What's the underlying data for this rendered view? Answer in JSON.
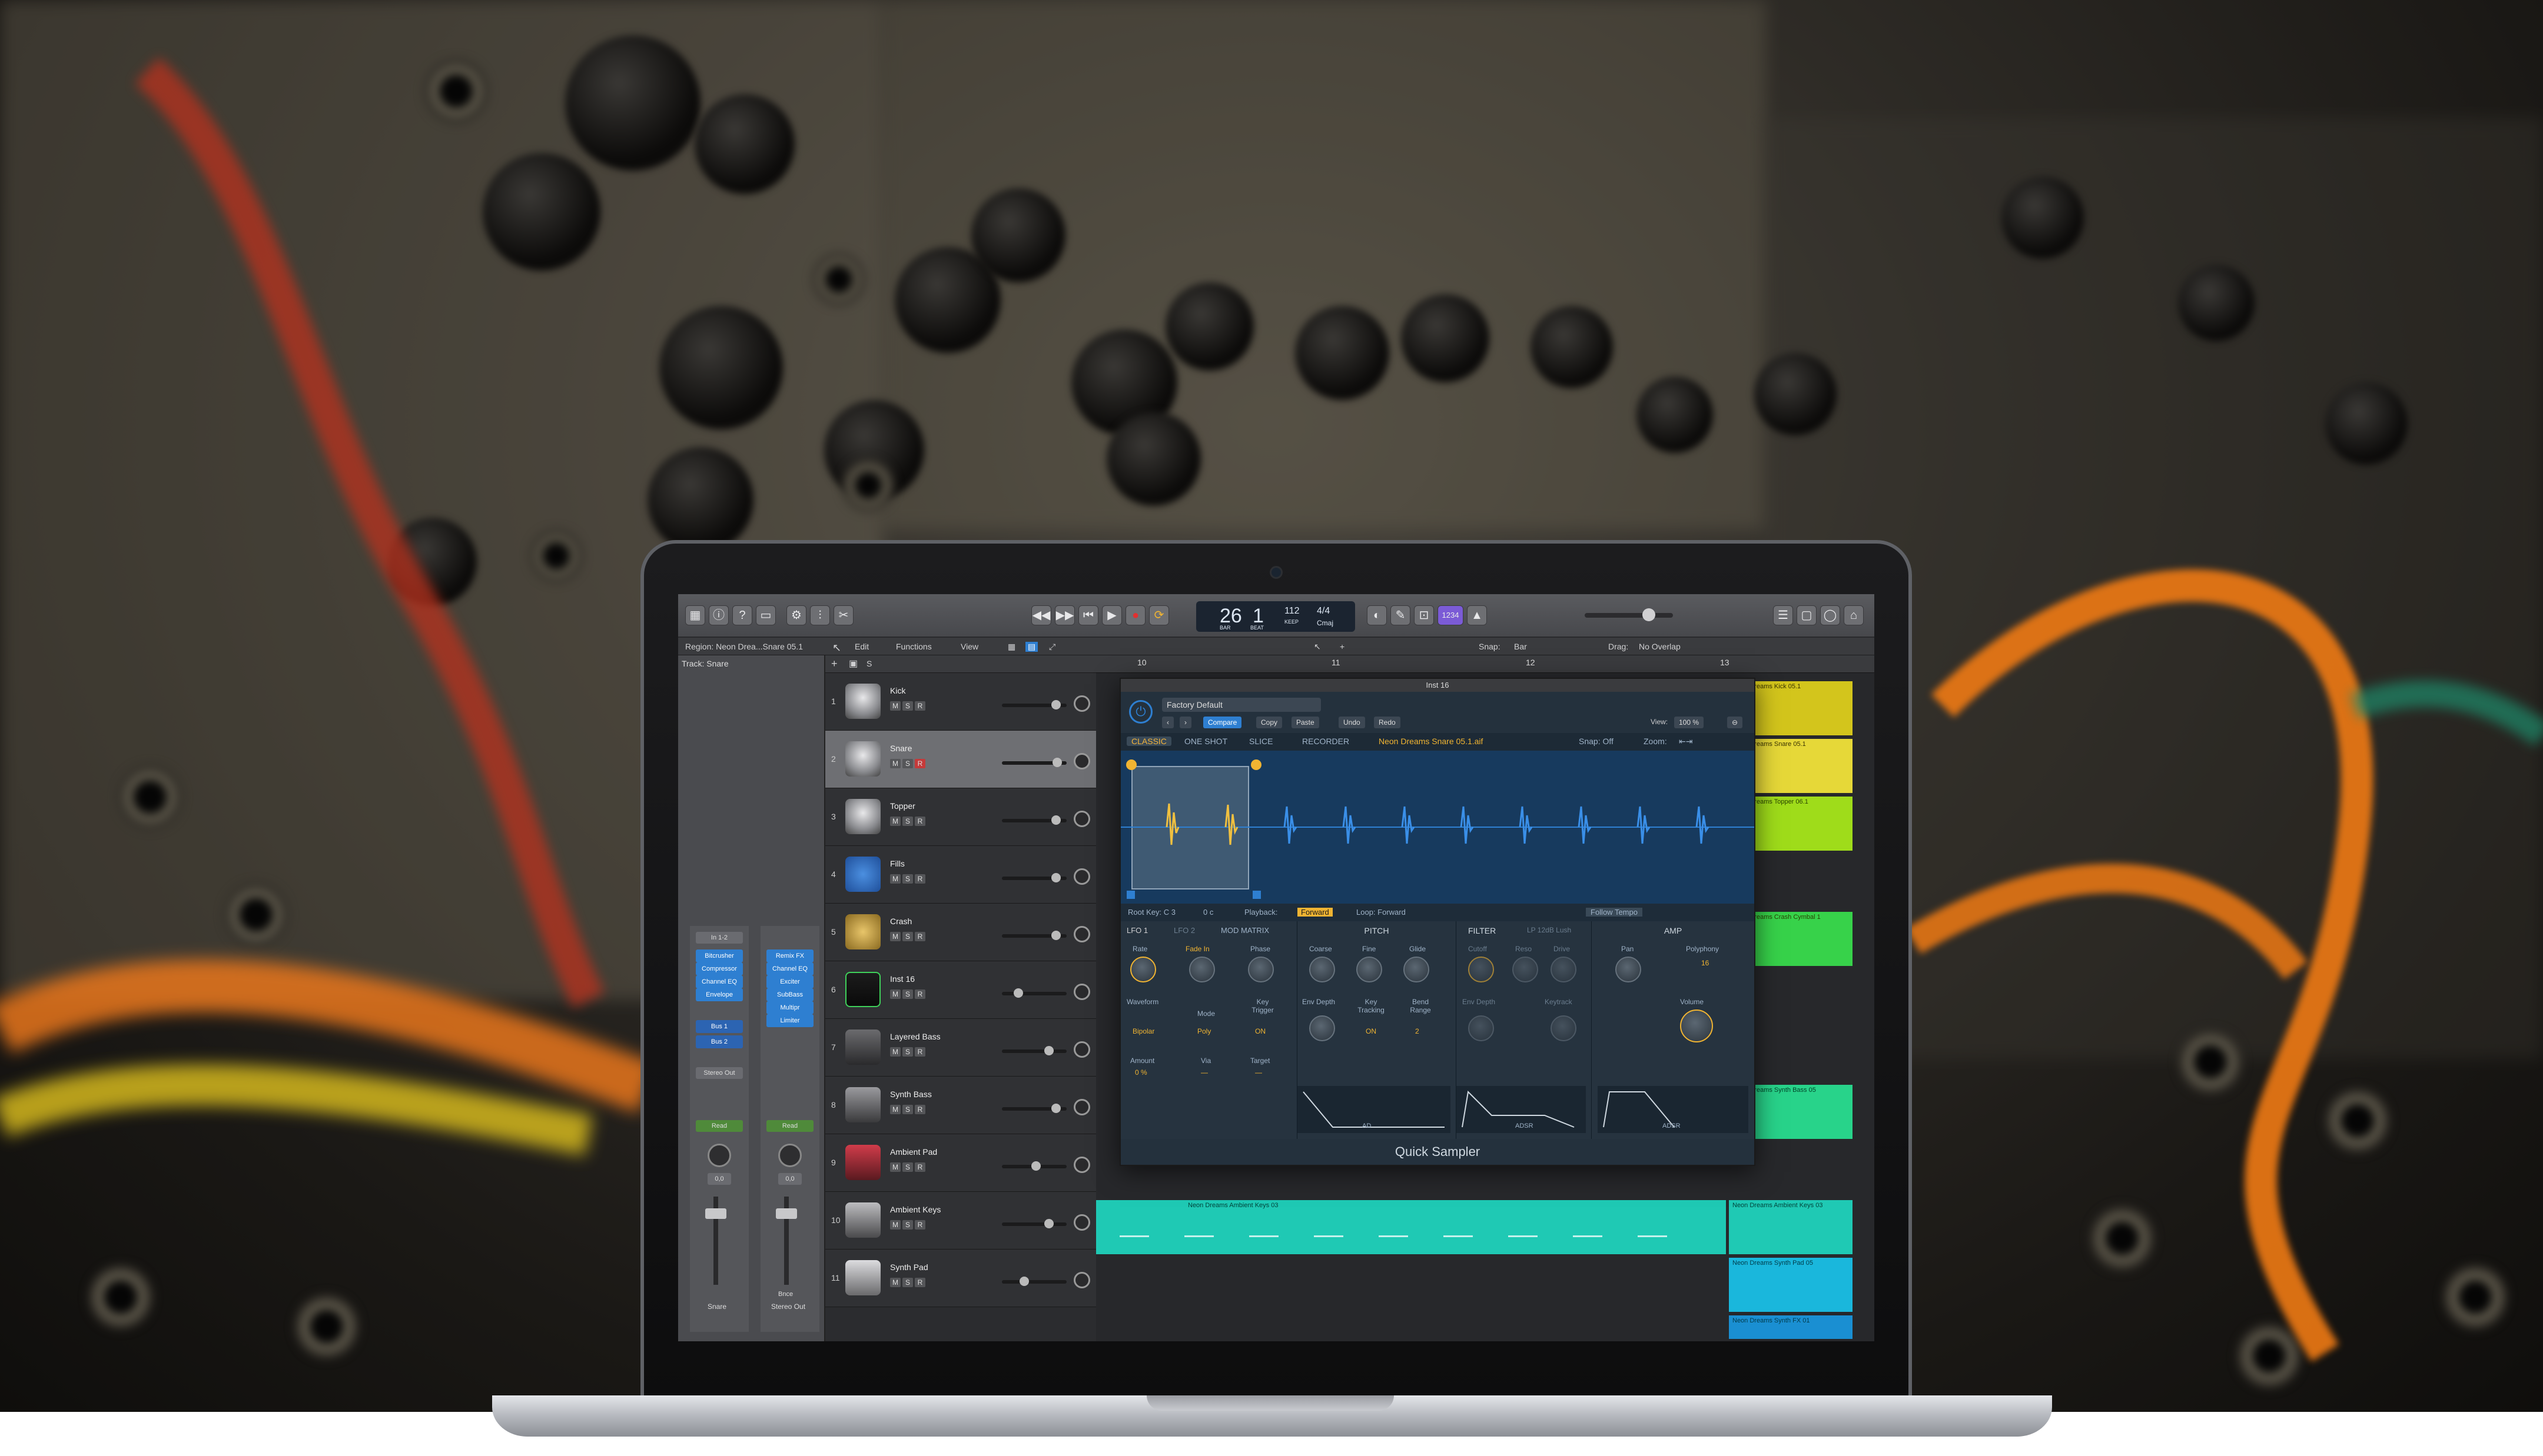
{
  "toolbar": {
    "lcd_bar": "26",
    "lcd_beat": "1",
    "lcd_tempo": "112",
    "lcd_signature": "4/4",
    "lcd_key": "Cmaj",
    "lcd_bar_label": "BAR",
    "lcd_beat_label": "BEAT",
    "lcd_tempo_label": "KEEP",
    "count": "1234"
  },
  "subbar": {
    "region": "Region: Neon Drea...Snare 05.1",
    "track": "Track: Snare",
    "edit": "Edit",
    "functions": "Functions",
    "view": "View",
    "snap_label": "Snap:",
    "snap_value": "Bar",
    "drag_label": "Drag:",
    "drag_value": "No Overlap"
  },
  "ruler": {
    "m10": "10",
    "m11": "11",
    "m12": "12",
    "m13": "13"
  },
  "inspector": {
    "strip1": {
      "plugins": [
        "Bitcrusher",
        "Compressor",
        "Channel EQ",
        "Envelope"
      ],
      "name": "Snare",
      "bus1": "Bus 1",
      "bus2": "Bus 2",
      "output": "Stereo Out",
      "read": "Read",
      "value": "0,0",
      "input": "In 1-2"
    },
    "strip2": {
      "plugins": [
        "Remix FX",
        "Channel EQ",
        "Exciter",
        "SubBass",
        "Multipr",
        "Limiter"
      ],
      "name": "Stereo Out",
      "read": "Read",
      "value": "0,0",
      "bnce": "Bnce"
    }
  },
  "tracks": [
    {
      "num": "1",
      "name": "Kick"
    },
    {
      "num": "2",
      "name": "Snare"
    },
    {
      "num": "3",
      "name": "Topper"
    },
    {
      "num": "4",
      "name": "Fills"
    },
    {
      "num": "5",
      "name": "Crash"
    },
    {
      "num": "6",
      "name": "Inst 16"
    },
    {
      "num": "7",
      "name": "Layered Bass"
    },
    {
      "num": "8",
      "name": "Synth Bass"
    },
    {
      "num": "9",
      "name": "Ambient Pad"
    },
    {
      "num": "10",
      "name": "Ambient Keys"
    },
    {
      "num": "11",
      "name": "Synth Pad"
    }
  ],
  "track_buttons": {
    "m": "M",
    "s": "S",
    "r": "R"
  },
  "regions": {
    "kick": "Neon Dreams Kick 05.1",
    "snare": "Neon Dreams Snare 05.1",
    "topper": "Neon Dreams Topper 06.1",
    "crash": "Neon Dreams Crash Cymbal 1",
    "synthbass": "Neon Dreams Synth Bass 05",
    "ambkeys1": "Neon Dreams Ambient Keys 03",
    "ambkeys2": "Neon Dreams Ambient Keys 03",
    "synthpad": "Neon Dreams Synth Pad 05",
    "synthfx": "Neon Dreams Synth FX 01"
  },
  "sampler": {
    "window_title": "Inst 16",
    "preset": "Factory Default",
    "compare": "Compare",
    "copy": "Copy",
    "paste": "Paste",
    "undo": "Undo",
    "redo": "Redo",
    "view_label": "View:",
    "view_value": "100 %",
    "mode_classic": "CLASSIC",
    "mode_oneshot": "ONE SHOT",
    "mode_slice": "SLICE",
    "mode_recorder": "RECORDER",
    "sample_name": "Neon Dreams Snare 05.1.aif",
    "snap": "Snap: Off",
    "zoom": "Zoom:",
    "root_key": "Root Key: C 3",
    "root_cents": "0 c",
    "playback_label": "Playback:",
    "playback_value": "Forward",
    "loop": "Loop: Forward",
    "follow_tempo": "Follow Tempo",
    "lfo1": "LFO 1",
    "lfo2": "LFO 2",
    "modmatrix": "MOD MATRIX",
    "pitch": "PITCH",
    "filter": "FILTER",
    "filter_type": "LP 12dB Lush",
    "amp": "AMP",
    "rate": "Rate",
    "fadein": "Fade In",
    "phase": "Phase",
    "waveform": "Waveform",
    "mode": "Mode",
    "key_trigger": "Key Trigger",
    "bipolar": "Bipolar",
    "poly": "Poly",
    "on": "ON",
    "coarse": "Coarse",
    "fine": "Fine",
    "glide": "Glide",
    "env_depth": "Env Depth",
    "key_tracking": "Key Tracking",
    "bend_range": "Bend Range",
    "key_tracking_val": "ON",
    "bend_val": "2",
    "cutoff": "Cutoff",
    "reso": "Reso",
    "drive": "Drive",
    "env_depth2": "Env Depth",
    "keytrack2": "Keytrack",
    "pan": "Pan",
    "polyphony": "Polyphony",
    "polyphony_val": "16",
    "volume": "Volume",
    "amount": "Amount",
    "amount_val": "0 %",
    "via": "Via",
    "via_val": "—",
    "target": "Target",
    "target_val": "—",
    "env_ad": "AD",
    "env_adsr1": "ADSR",
    "env_adsr2": "ADSR",
    "footer": "Quick Sampler"
  },
  "colors": {
    "accent_orange": "#f0b432",
    "selected_blue": "#2e7fd1",
    "wave_blue": "#173a5e"
  }
}
